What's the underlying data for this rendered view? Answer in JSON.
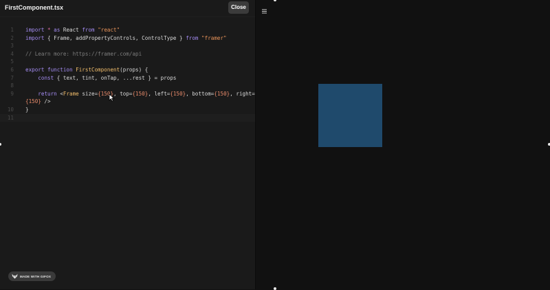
{
  "editor": {
    "filename": "FirstComponent.tsx",
    "close_label": "Close",
    "line_numbers": [
      "1",
      "2",
      "3",
      "4",
      "5",
      "6",
      "7",
      "8",
      "9",
      "",
      "10",
      "11"
    ],
    "lines": [
      [
        [
          "kw",
          "import "
        ],
        [
          "op",
          "* "
        ],
        [
          "kw",
          "as "
        ],
        [
          "",
          "React "
        ],
        [
          "kw",
          "from "
        ],
        [
          "str",
          "\"react\""
        ]
      ],
      [
        [
          "kw",
          "import "
        ],
        [
          "",
          "{ Frame, addPropertyControls, ControlType } "
        ],
        [
          "kw",
          "from "
        ],
        [
          "str",
          "\"framer\""
        ]
      ],
      [],
      [
        [
          "cmt",
          "// Learn more: https://framer.com/api"
        ]
      ],
      [],
      [
        [
          "kw",
          "export function "
        ],
        [
          "fn",
          "FirstComponent"
        ],
        [
          "",
          "(props) {"
        ]
      ],
      [
        [
          "",
          "    "
        ],
        [
          "kw",
          "const "
        ],
        [
          "",
          "{ text, tint, onTap, ...rest } = props"
        ]
      ],
      [],
      [
        [
          "",
          "    "
        ],
        [
          "kw",
          "return "
        ],
        [
          "",
          "<"
        ],
        [
          "fn",
          "Frame "
        ],
        [
          "",
          "size="
        ],
        [
          "num",
          "{150}"
        ],
        [
          "",
          ", top="
        ],
        [
          "num",
          "{150}"
        ],
        [
          "",
          ", left="
        ],
        [
          "num",
          "{150}"
        ],
        [
          "",
          ", bottom="
        ],
        [
          "num",
          "{150}"
        ],
        [
          "",
          ", right="
        ]
      ],
      [
        [
          "num",
          "{150}"
        ],
        [
          "",
          " />"
        ]
      ],
      [
        [
          "",
          "}"
        ]
      ],
      []
    ]
  },
  "badge": {
    "label": "MADE WITH GIFOX"
  },
  "preview": {
    "frame_color": "#1f4a6c",
    "icon": "hamburger-menu-icon"
  },
  "colors": {
    "editor_bg": "#1a1a1a",
    "preview_bg": "#111111"
  }
}
